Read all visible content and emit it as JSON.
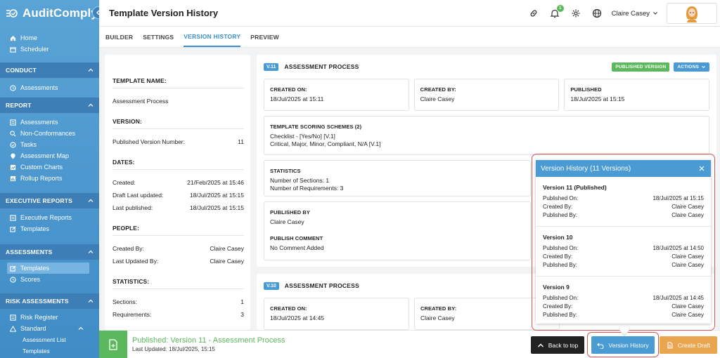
{
  "app": {
    "name": "AuditComply"
  },
  "sidebar": {
    "top_items": [
      {
        "label": "Home",
        "icon": "home-icon"
      },
      {
        "label": "Scheduler",
        "icon": "calendar-icon"
      }
    ],
    "conduct": {
      "title": "CONDUCT",
      "items": [
        {
          "label": "Assessments"
        }
      ]
    },
    "report": {
      "title": "REPORT",
      "items": [
        {
          "label": "Assessments"
        },
        {
          "label": "Non-Conformances"
        },
        {
          "label": "Tasks"
        },
        {
          "label": "Assessment Map"
        },
        {
          "label": "Custom Charts"
        },
        {
          "label": "Rollup Reports"
        }
      ]
    },
    "executive": {
      "title": "EXECUTIVE REPORTS",
      "items": [
        {
          "label": "Executive Reports"
        },
        {
          "label": "Templates"
        }
      ]
    },
    "assessments": {
      "title": "ASSESSMENTS",
      "items": [
        {
          "label": "Templates"
        },
        {
          "label": "Scores"
        }
      ]
    },
    "risk": {
      "title": "RISK ASSESSMENTS",
      "items": [
        {
          "label": "Risk Register"
        },
        {
          "label": "Standard"
        }
      ],
      "sub_items": [
        {
          "label": "Assessment List"
        },
        {
          "label": "Templates"
        }
      ]
    }
  },
  "header": {
    "title": "Template Version History",
    "user_name": "Claire Casey",
    "notification_count": "1"
  },
  "tabs": [
    {
      "label": "BUILDER"
    },
    {
      "label": "SETTINGS"
    },
    {
      "label": "VERSION HISTORY"
    },
    {
      "label": "PREVIEW"
    }
  ],
  "info": {
    "template_name_heading": "TEMPLATE NAME:",
    "template_name": "Assessment Process",
    "version_heading": "VERSION:",
    "version_label": "Published Version Number:",
    "version_value": "11",
    "dates_heading": "DATES:",
    "dates": [
      {
        "label": "Created:",
        "value": "21/Feb/2025 at 15:46"
      },
      {
        "label": "Draft Last updated:",
        "value": "18/Jul/2025 at 15:15"
      },
      {
        "label": "Last published:",
        "value": "18/Jul/2025 at 15:15"
      }
    ],
    "people_heading": "PEOPLE:",
    "people": [
      {
        "label": "Created By:",
        "value": "Claire Casey"
      },
      {
        "label": "Last Updated By:",
        "value": "Claire Casey"
      }
    ],
    "stats_heading": "STATISTICS:",
    "stats": [
      {
        "label": "Sections:",
        "value": "1"
      },
      {
        "label": "Requirements:",
        "value": "3"
      }
    ]
  },
  "card1": {
    "tag": "V.11",
    "title": "ASSESSMENT PROCESS",
    "published_badge": "PUBLISHED VERSION",
    "actions_label": "ACTIONS",
    "created_on_label": "CREATED ON:",
    "created_on": "18/Jul/2025 at 15:11",
    "created_by_label": "CREATED BY:",
    "created_by": "Claire Casey",
    "published_label": "PUBLISHED",
    "published": "18/Jul/2025 at 15:15",
    "scoring_label": "TEMPLATE SCORING SCHEMES (2)",
    "scoring": [
      "Checklist - [Yes/No] [V.1]",
      "Critical, Major, Minor, Compliant, N/A [V.1]"
    ],
    "stats_label": "STATISTICS",
    "stats": [
      "Number of Sections: 1",
      "Number of Requirements: 3"
    ],
    "published_by_label": "PUBLISHED BY",
    "published_by": "Claire Casey",
    "comment_label": "PUBLISH COMMENT",
    "comment": "No Comment Added"
  },
  "card2": {
    "tag": "V.10",
    "title": "ASSESSMENT PROCESS",
    "created_on_label": "CREATED ON:",
    "created_on": "18/Jul/2025 at 14:45",
    "created_by_label": "CREATED BY:",
    "created_by": "Claire Casey"
  },
  "version_popup": {
    "title": "Version History (11 Versions)",
    "published_on_label": "Published On:",
    "created_by_label": "Created By:",
    "published_by_label": "Published By:",
    "entries": [
      {
        "name": "Version 11 (Published)",
        "published_on": "18/Jul/2025 at 15:15",
        "created_by": "Claire Casey",
        "published_by": "Claire Casey"
      },
      {
        "name": "Version 10",
        "published_on": "18/Jul/2025 at 14:50",
        "created_by": "Claire Casey",
        "published_by": "Claire Casey"
      },
      {
        "name": "Version 9",
        "published_on": "18/Jul/2025 at 14:45",
        "created_by": "Claire Casey",
        "published_by": "Claire Casey"
      }
    ]
  },
  "footer": {
    "title": "Published: Version 11 - Assessment Process",
    "subtitle": "Last Updated: 18/Jul/2025, 15:15",
    "back_to_top": "Back to top",
    "version_history": "Version History",
    "create_draft": "Create Draft"
  },
  "colors": {
    "primary": "#4a9ad4",
    "success": "#5cb85c",
    "warning": "#e9a64e",
    "highlight": "#d9534f"
  }
}
